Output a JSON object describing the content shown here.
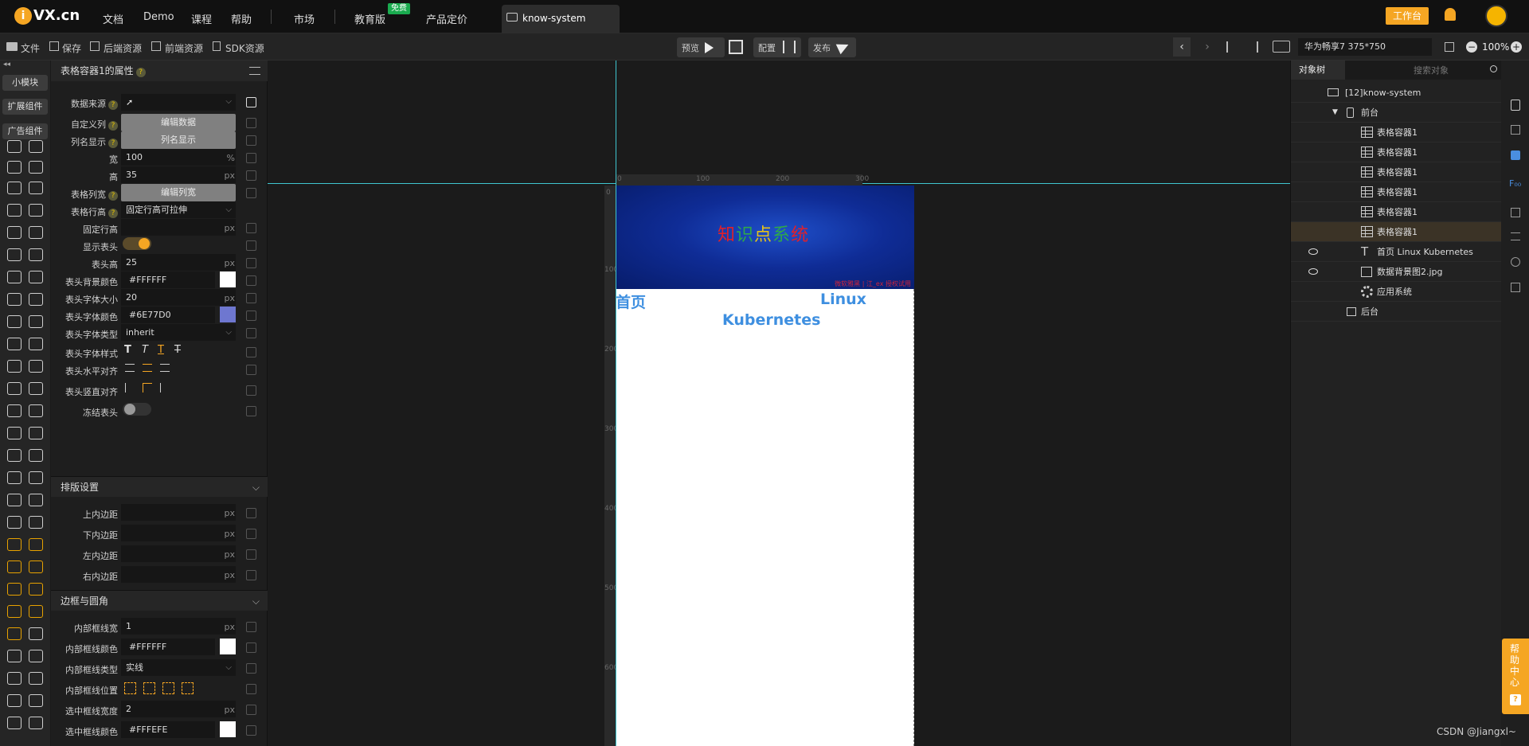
{
  "topbar": {
    "logo_text": "VX.cn",
    "nav": [
      "文档",
      "Demo",
      "课程",
      "帮助"
    ],
    "market": "市场",
    "edu": "教育版",
    "free_badge": "免费",
    "pricing": "产品定价",
    "doc_tab": "know-system",
    "workspace": "工作台"
  },
  "toolbar": {
    "file": "文件",
    "save": "保存",
    "backend_res": "后端资源",
    "frontend_res": "前端资源",
    "sdk_res": "SDK资源",
    "preview": "预览",
    "config": "配置",
    "publish": "发布",
    "device": "华为畅享7 375*750",
    "zoom": "100%"
  },
  "left_cats": [
    "小模块",
    "扩展组件",
    "广告组件"
  ],
  "props": {
    "title": "表格容器1的属性",
    "rows": {
      "datasource": "数据来源",
      "custom_cols": "自定义列",
      "edit_data": "编辑数据",
      "col_display_lbl": "列名显示",
      "col_display_btn": "列名显示",
      "width_lbl": "宽",
      "width_val": "100",
      "width_unit": "%",
      "height_lbl": "高",
      "height_val": "35",
      "px": "px",
      "col_width_lbl": "表格列宽",
      "col_width_btn": "编辑列宽",
      "row_height_lbl": "表格行高",
      "row_height_val": "固定行高可拉伸",
      "fixed_row_lbl": "固定行高",
      "show_header_lbl": "显示表头",
      "header_h_lbl": "表头高",
      "header_h_val": "25",
      "header_bg_lbl": "表头背景颜色",
      "header_bg_val": "#FFFFFF",
      "header_fs_lbl": "表头字体大小",
      "header_fs_val": "20",
      "header_fc_lbl": "表头字体颜色",
      "header_fc_val": "#6E77D0",
      "header_ff_lbl": "表头字体类型",
      "header_ff_val": "inherit",
      "header_style_lbl": "表头字体样式",
      "header_halign_lbl": "表头水平对齐",
      "header_valign_lbl": "表头竖直对齐",
      "freeze_lbl": "冻结表头"
    },
    "layout_section": "排版设置",
    "padding": [
      "上内边距",
      "下内边距",
      "左内边距",
      "右内边距"
    ],
    "border_section": "边框与圆角",
    "border": {
      "inner_w_lbl": "内部框线宽",
      "inner_w_val": "1",
      "inner_c_lbl": "内部框线颜色",
      "inner_c_val": "#FFFFFF",
      "inner_t_lbl": "内部框线类型",
      "inner_t_val": "实线",
      "inner_p_lbl": "内部框线位置",
      "sel_w_lbl": "选中框线宽度",
      "sel_w_val": "2",
      "sel_c_lbl": "选中框线颜色",
      "sel_c_val": "#FFFEFE"
    }
  },
  "canvas": {
    "ruler_top": [
      "0",
      "100",
      "200",
      "300"
    ],
    "ruler_left": [
      "0",
      "100",
      "200",
      "300",
      "400",
      "500",
      "600"
    ],
    "banner_title": [
      "知",
      "识",
      "点",
      "系",
      "统"
    ],
    "banner_note": "微软雅黑 | 江_ex 授权试用",
    "header_cells": [
      "首页",
      "Linux",
      "Kubernetes"
    ]
  },
  "objtree": {
    "tab": "对象树",
    "search_placeholder": "搜索对象",
    "project": "[12]know-system",
    "frontend": "前台",
    "tables": [
      "表格容器1",
      "表格容器1",
      "表格容器1",
      "表格容器1",
      "表格容器1",
      "表格容器1"
    ],
    "text_node": "首页 Linux Kubernetes",
    "image_node": "数据背景图2.jpg",
    "app_node": "应用系统",
    "backend": "后台"
  },
  "help_center": [
    "帮",
    "助",
    "中",
    "心",
    "?"
  ],
  "watermark": "CSDN @Jiangxl~",
  "colors": {
    "accent": "#F5A623",
    "header_font": "#6E77D0",
    "header_text_blue": "#3E8FE0",
    "selected_row": "#3B3326"
  }
}
